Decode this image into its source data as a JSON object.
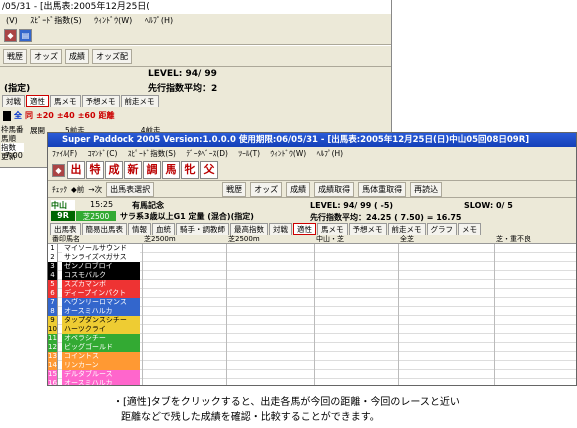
{
  "back_window": {
    "title": "/05/31 - [出馬表:2005年12月25日(",
    "menu": [
      "(V)",
      "ｽﾋﾟｰﾄﾞ指数(S)",
      "ｳｨﾝﾄﾞｳ(W)",
      "ﾍﾙﾌﾟ(H)"
    ],
    "toolbar": [
      "戦歴",
      "オッズ",
      "成績",
      "オッズ配"
    ],
    "level": "LEVEL:  94/ 99",
    "shitei": "(指定)",
    "sakko": "先行指数平均：2",
    "tabs": [
      "対戦",
      "適性",
      "馬メモ",
      "予想メモ",
      "前走メモ"
    ],
    "filter": [
      "全",
      "同",
      "±20",
      "±40",
      "±60",
      "距離"
    ],
    "side_labels": [
      "枠馬番",
      "馬順",
      "指数",
      "更新"
    ],
    "side_val": "7.00",
    "col_hdr": [
      "展開",
      "5前走",
      "4前走"
    ]
  },
  "front_window": {
    "title": "Super Paddock 2005 Version:1.0.0.0  使用期限:06/05/31 - [出馬表:2005年12月25日(日)中山05回08日09R]",
    "menu": [
      "ﾌｧｲﾙ(F)",
      "ｺﾏﾝﾄﾞ(C)",
      "ｽﾋﾟｰﾄﾞ指数(S)",
      "ﾃﾞｰﾀﾍﾞｰｽ(D)",
      "ﾂｰﾙ(T)",
      "ｳｨﾝﾄﾞｳ(W)",
      "ﾍﾙﾌﾟ(H)"
    ],
    "big_buttons": [
      "出",
      "特",
      "成",
      "新",
      "調",
      "馬",
      "牝",
      "父"
    ],
    "nav": [
      "ﾁｪｯｸ",
      "◆前",
      "→次",
      "出馬表選択"
    ],
    "toolbar": [
      "戦歴",
      "オッズ",
      "成績",
      "成績取得",
      "馬体重取得",
      "再読込"
    ],
    "venue": "中山",
    "time": "15:25",
    "race_name": "有馬記念",
    "race_no": "9R",
    "course": "芝2500",
    "race_cond": "サラ系3歳以上G1  定量 (混合)(指定)",
    "level": "LEVEL:  94/ 99 ( -5)",
    "slow": "SLOW:  0/ 5",
    "sakko": "先行指数平均：24.25  ( 7.50) = 16.75",
    "tabs": [
      "出馬表",
      "簡易出馬表",
      "情報",
      "血統",
      "騎手・調教師",
      "最高指数",
      "対戦",
      "適性",
      "馬メモ",
      "予想メモ",
      "前走メモ",
      "グラフ",
      "メモ"
    ],
    "active_tab": "適性",
    "col_headers": [
      "番印馬名",
      "芝2500m",
      "芝2500m",
      "中山・芝",
      "全芝",
      "芝・重不良"
    ],
    "horses": [
      {
        "no": "1",
        "name": "マイソールサウンド",
        "c": "#fff"
      },
      {
        "no": "2",
        "name": "サンライズペガサス",
        "c": "#fff"
      },
      {
        "no": "3",
        "name": "ゼンノロブロイ",
        "c": "#000"
      },
      {
        "no": "4",
        "name": "コスモバルク",
        "c": "#000"
      },
      {
        "no": "5",
        "name": "スズカマンボ",
        "c": "#e33"
      },
      {
        "no": "6",
        "name": "ディープインパクト",
        "c": "#e33"
      },
      {
        "no": "7",
        "name": "ヘヴンリーロマンス",
        "c": "#36c"
      },
      {
        "no": "8",
        "name": "オースミハルカ",
        "c": "#36c"
      },
      {
        "no": "9",
        "name": "タップダンスシチー",
        "c": "#ec3"
      },
      {
        "no": "10",
        "name": "ハーツクライ",
        "c": "#ec3"
      },
      {
        "no": "11",
        "name": "オペラシチー",
        "c": "#3a3"
      },
      {
        "no": "12",
        "name": "ビッグゴールド",
        "c": "#3a3"
      },
      {
        "no": "13",
        "name": "コイントス",
        "c": "#f93"
      },
      {
        "no": "14",
        "name": "リンカーン",
        "c": "#f93"
      },
      {
        "no": "15",
        "name": "デルタブルース",
        "c": "#f6c"
      },
      {
        "no": "16",
        "name": "オースミハルカ",
        "c": "#f6c"
      }
    ]
  },
  "caption": {
    "line1": "・[適性]タブをクリックすると、出走各馬が今回の距離・今回のレースと近い",
    "line2": "距離などで残した成績を確認・比較することができます。"
  }
}
